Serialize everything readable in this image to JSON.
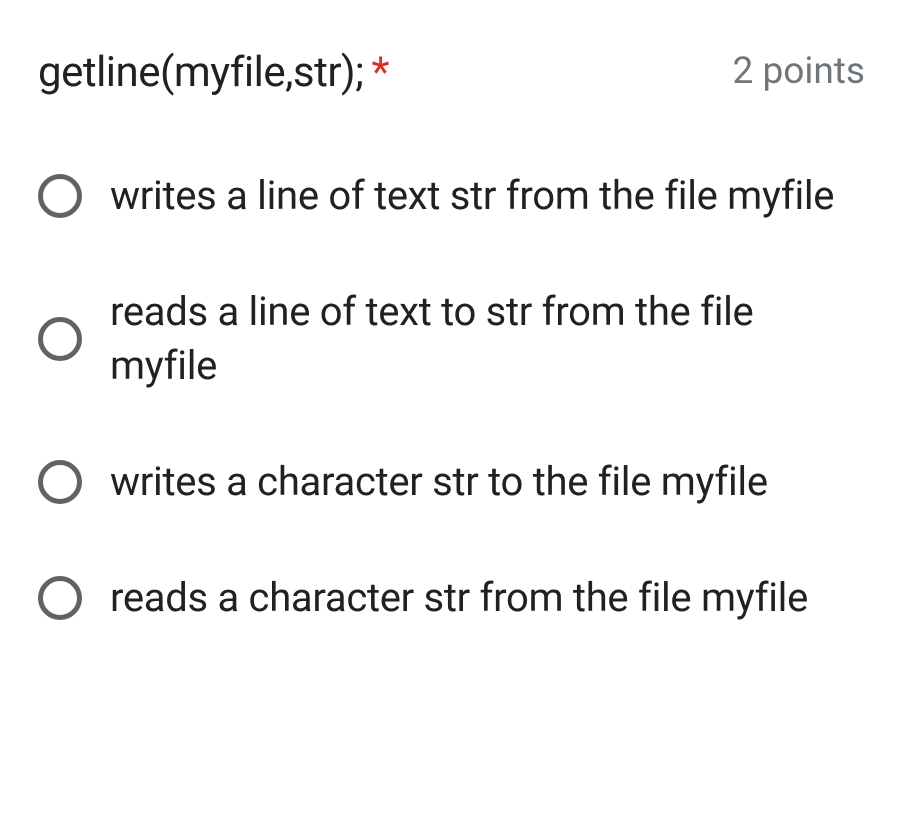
{
  "question": {
    "title": "getline(myfile,str);",
    "required": true,
    "points_label": "2 points",
    "options": [
      {
        "label": "writes a line of text str from the file myfile"
      },
      {
        "label": "reads a line of text to str from the file myfile"
      },
      {
        "label": "writes a character str to the file myfile"
      },
      {
        "label": "reads a character str from the file myfile"
      }
    ]
  }
}
